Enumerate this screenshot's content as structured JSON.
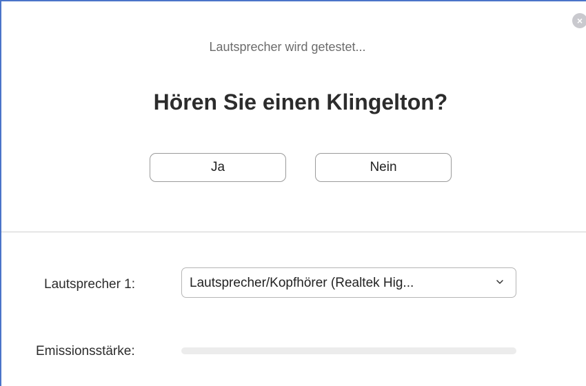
{
  "dialog": {
    "close_icon": "close-icon",
    "close_glyph": "×",
    "status_text": "Lautsprecher wird getestet...",
    "question": "Hören Sie einen Klingelton?",
    "buttons": {
      "yes_label": "Ja",
      "no_label": "Nein"
    }
  },
  "speaker": {
    "label": "Lautsprecher 1:",
    "selected": "Lautsprecher/Kopfhörer (Realtek Hig...",
    "dropdown_icon": "chevron-down-icon"
  },
  "emission": {
    "label": "Emissionsstärke:",
    "level": 0
  },
  "colors": {
    "window_border": "#4a74c9",
    "close_button": "#c9c9ce",
    "level_track": "#ececec"
  }
}
